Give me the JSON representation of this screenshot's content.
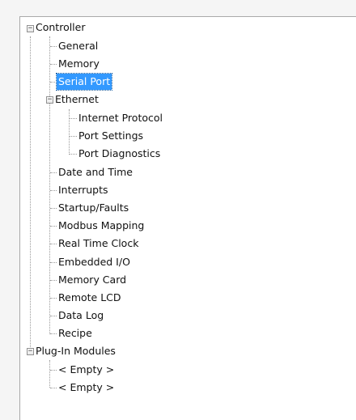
{
  "tree": {
    "controller": {
      "label": "Controller",
      "expanded": true,
      "children": {
        "general": "General",
        "memory": "Memory",
        "serial_port": "Serial Port",
        "ethernet": {
          "label": "Ethernet",
          "expanded": true,
          "children": {
            "internet_protocol": "Internet Protocol",
            "port_settings": "Port Settings",
            "port_diagnostics": "Port Diagnostics"
          }
        },
        "date_and_time": "Date and Time",
        "interrupts": "Interrupts",
        "startup_faults": "Startup/Faults",
        "modbus_mapping": "Modbus Mapping",
        "real_time_clock": "Real Time Clock",
        "embedded_io": "Embedded I/O",
        "memory_card": "Memory Card",
        "remote_lcd": "Remote LCD",
        "data_log": "Data Log",
        "recipe": "Recipe"
      }
    },
    "plugin_modules": {
      "label": "Plug-In Modules",
      "expanded": true,
      "children": {
        "empty_1": "< Empty >",
        "empty_2": "< Empty >"
      }
    },
    "selected_item": "Serial Port",
    "colors": {
      "selection_background": "#3399ff",
      "selection_text": "#ffffff",
      "connector_lines": "#9a9a9a"
    }
  }
}
